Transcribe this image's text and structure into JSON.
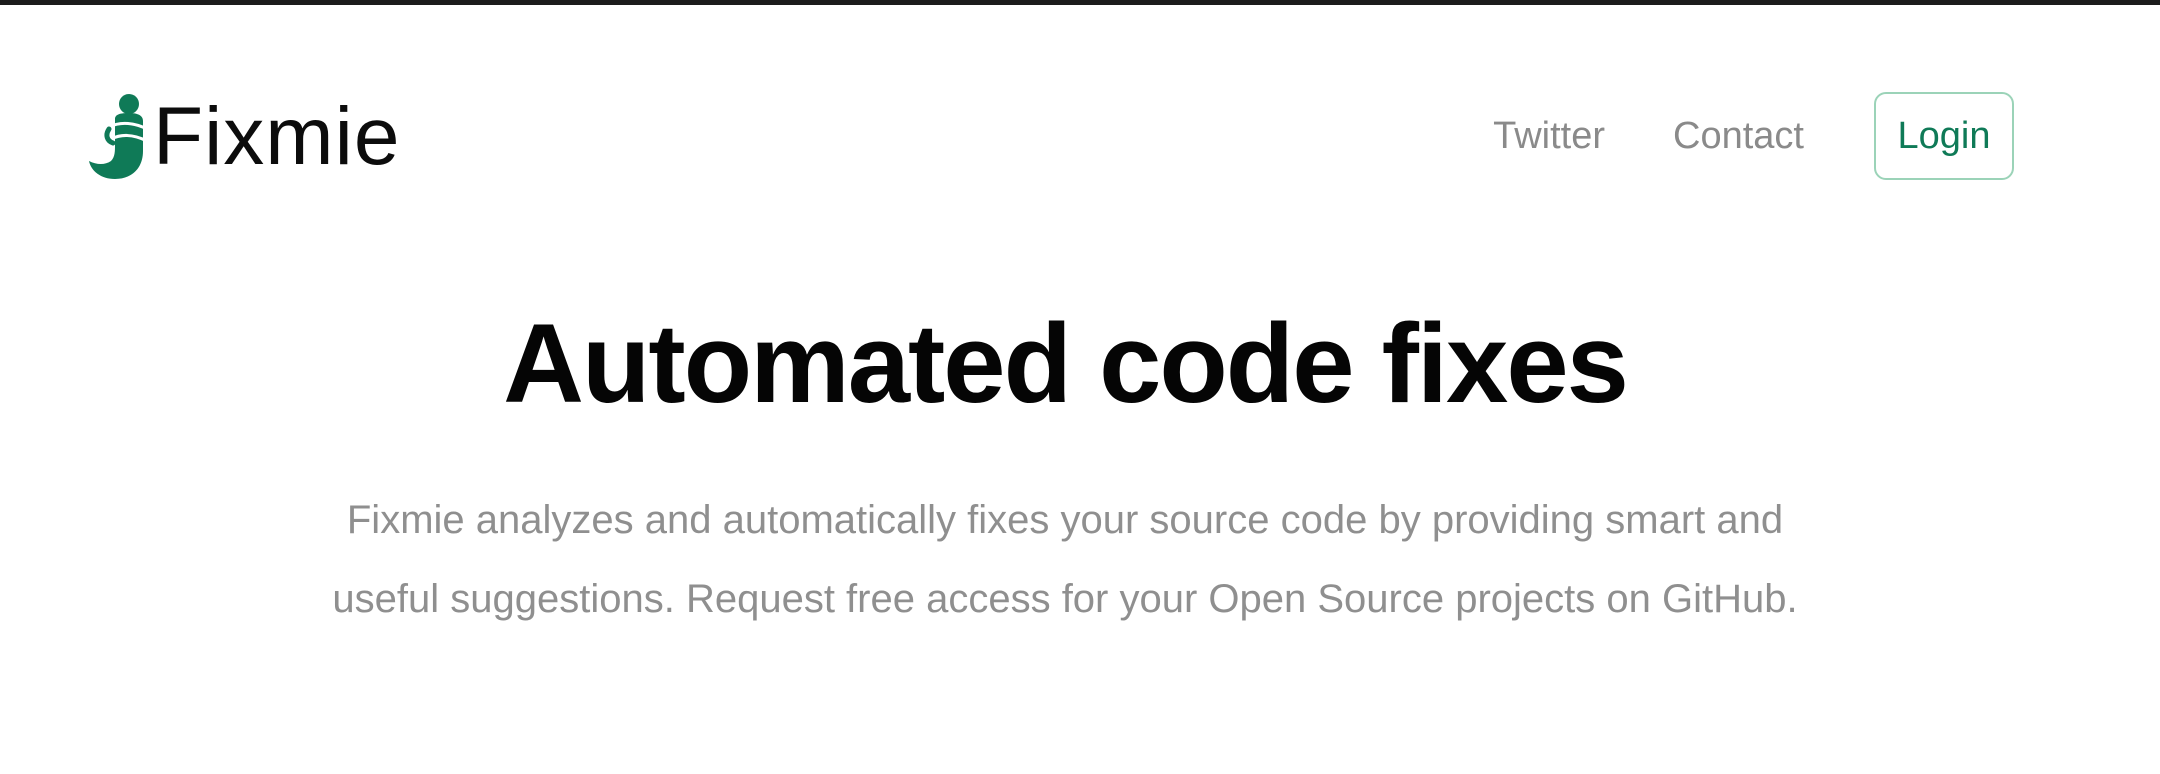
{
  "brand": {
    "name": "Fixmie",
    "logo_icon": "genie-logo-icon",
    "color": "#0f7a57"
  },
  "nav": {
    "links": [
      "Twitter",
      "Contact"
    ],
    "login_label": "Login"
  },
  "hero": {
    "title": "Automated code fixes",
    "subtitle": "Fixmie analyzes and automatically fixes your source code by providing smart and useful suggestions. Request free access for your Open Source projects on GitHub."
  },
  "colors": {
    "accent": "#0f7a57",
    "login_border": "#9bd3b8",
    "muted_text": "#8f8f8f",
    "heading_text": "#050505",
    "top_rule": "#1c1c1c"
  }
}
